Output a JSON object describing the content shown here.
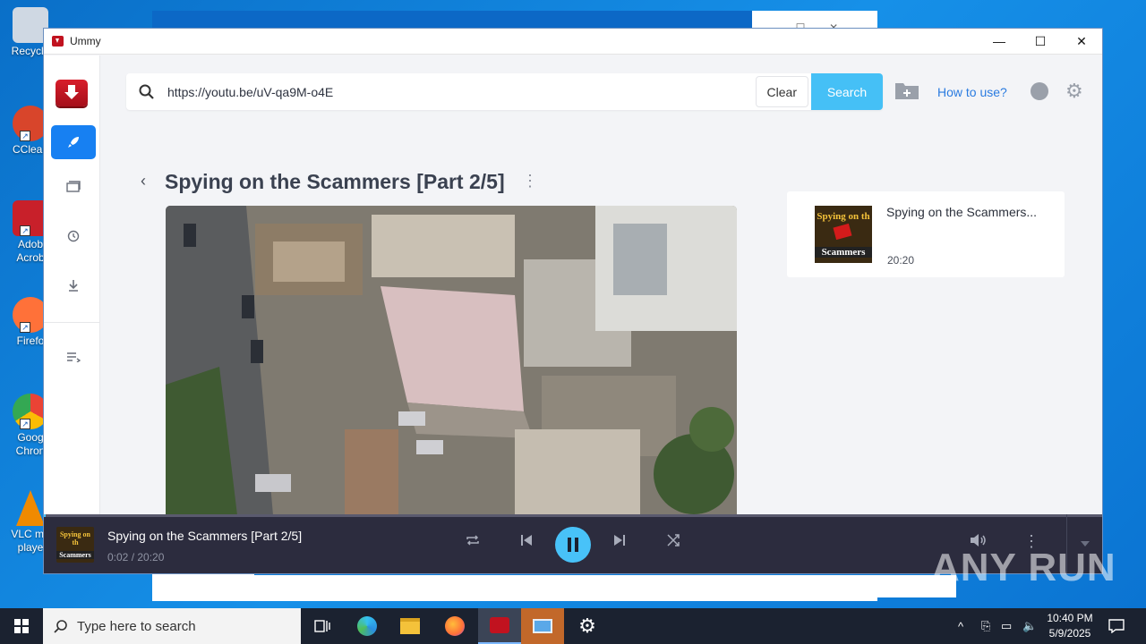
{
  "desktop": {
    "icons": [
      {
        "label": "Recycle",
        "color": "#cfd8e3"
      },
      {
        "label": "CClean",
        "color": "#d8452b"
      },
      {
        "label": "Adob Acrob",
        "color": "#c8202a"
      },
      {
        "label": "Firefo",
        "color": "#ff7139"
      },
      {
        "label": "Goog Chron",
        "color": "#4285f4"
      },
      {
        "label": "VLC me playe",
        "color": "#f08a00"
      }
    ]
  },
  "app": {
    "title": "Ummy",
    "window_controls": {
      "minimize": "—",
      "maximize": "☐",
      "close": "✕"
    },
    "search": {
      "url": "https://youtu.be/uV-qa9M-o4E",
      "clear_label": "Clear",
      "search_label": "Search"
    },
    "how_to_label": "How to use?",
    "video": {
      "title": "Spying on the Scammers [Part 2/5]"
    },
    "playlist": [
      {
        "title": "Spying on the Scammers...",
        "duration": "20:20",
        "thumb_top": "Spying on th",
        "thumb_bottom": "Scammers"
      }
    ],
    "player": {
      "title": "Spying on the Scammers [Part 2/5]",
      "time": "0:02 / 20:20",
      "thumb_top": "Spying on th",
      "thumb_bottom": "Scammers"
    }
  },
  "taskbar": {
    "search_placeholder": "Type here to search",
    "time": "10:40 PM",
    "date": "5/9/2025"
  },
  "watermark": "ANY RUN"
}
